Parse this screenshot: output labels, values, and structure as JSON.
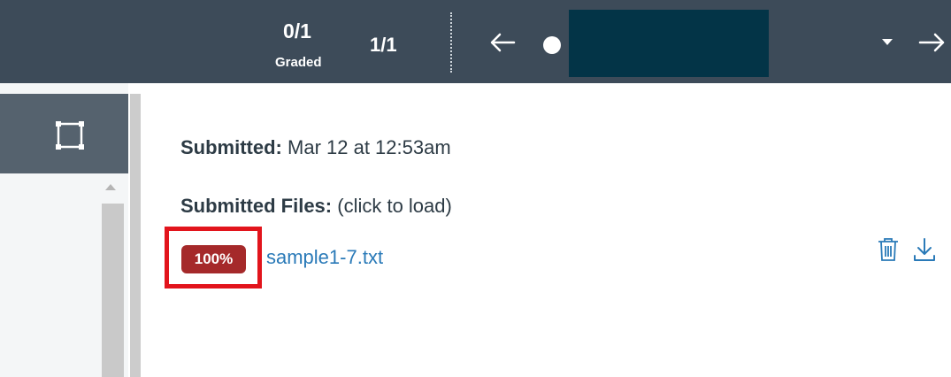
{
  "header": {
    "graded_count": "0/1",
    "graded_label": "Graded",
    "page_count": "1/1",
    "colors": {
      "bar": "#3d4b59",
      "student_select": "#033447"
    }
  },
  "submission": {
    "submitted_label": "Submitted:",
    "submitted_value": "Mar 12 at 12:53am",
    "files_label": "Submitted Files:",
    "files_hint": "(click to load)",
    "files": [
      {
        "percent": "100%",
        "name": "sample1-7.txt"
      }
    ],
    "colors": {
      "badge": "#a5292a",
      "link": "#2a7ab8",
      "highlight": "#e2141c"
    }
  },
  "icons": {
    "prev": "arrow-left-icon",
    "next": "arrow-right-icon",
    "dropdown": "caret-down-icon",
    "region": "region-select-icon",
    "trash": "trash-icon",
    "download": "download-icon"
  }
}
